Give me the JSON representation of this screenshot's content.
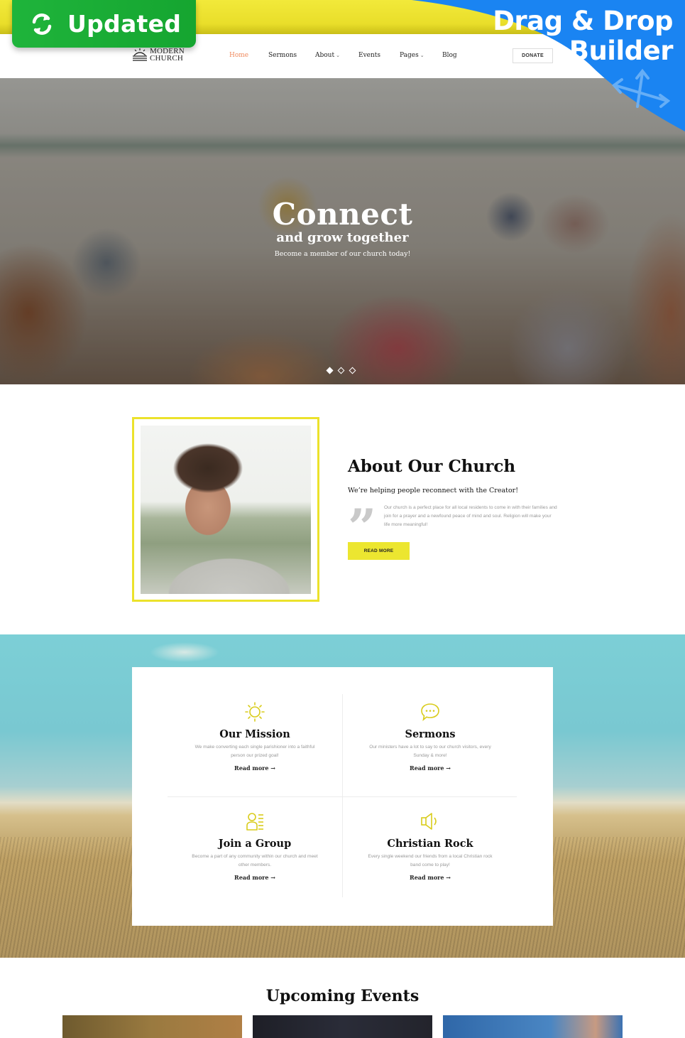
{
  "promo": {
    "updated_label": "Updated",
    "drag_drop_line1": "Drag & Drop",
    "drag_drop_line2": "Builder",
    "colors": {
      "updated_green": "#1fb43b",
      "builder_blue": "#1a84f2",
      "strip_yellow": "#f2e93a"
    }
  },
  "header": {
    "logo": {
      "line1": "MODERN",
      "line2": "CHURCH"
    },
    "nav": [
      {
        "label": "Home",
        "active": true,
        "dropdown": false
      },
      {
        "label": "Sermons",
        "active": false,
        "dropdown": false
      },
      {
        "label": "About",
        "active": false,
        "dropdown": true
      },
      {
        "label": "Events",
        "active": false,
        "dropdown": false
      },
      {
        "label": "Pages",
        "active": false,
        "dropdown": true
      },
      {
        "label": "Blog",
        "active": false,
        "dropdown": false
      }
    ],
    "dropdown_glyph": "⌄",
    "donate_label": "DONATE",
    "active_color": "#f08a5d"
  },
  "hero": {
    "title": "Connect",
    "subtitle": "and grow together",
    "description": "Become a member of our church today!",
    "slides": {
      "total": 3,
      "active_index": 0
    }
  },
  "about": {
    "title": "About Our Church",
    "subtitle": "We’re helping people reconnect with the Creator!",
    "quote_glyph": "”",
    "body": "Our church is a perfect place for all local residents to come in with their families and join for a prayer and a newfound peace of mind and soul. Religion will make your life more meaningful!",
    "button_label": "READ MORE",
    "accent_color": "#ece22b"
  },
  "services": {
    "link_label": "Read more →",
    "items": [
      {
        "icon": "sun-icon",
        "title": "Our Mission",
        "description": "We make converting each single parishioner into a faithful person our prized goal!"
      },
      {
        "icon": "speech-bubble-icon",
        "title": "Sermons",
        "description": "Our ministers have a lot to say to our church visitors, every Sunday & more!"
      },
      {
        "icon": "group-member-icon",
        "title": "Join a Group",
        "description": "Become a part of any community within our church and meet other members."
      },
      {
        "icon": "speaker-icon",
        "title": "Christian Rock",
        "description": "Every single weekend our friends from a local Christian rock band come to play!"
      }
    ],
    "icon_color": "#d9cc1b"
  },
  "events": {
    "title": "Upcoming Events"
  }
}
